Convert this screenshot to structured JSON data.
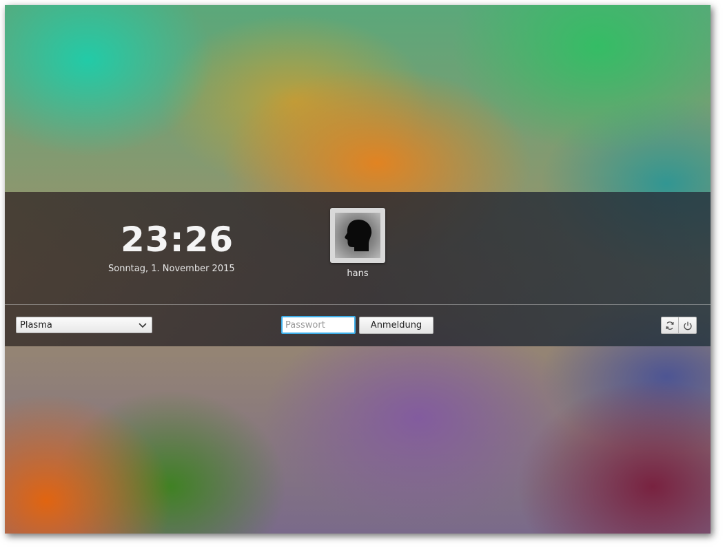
{
  "clock": {
    "time": "23:26",
    "date": "Sonntag, 1. November 2015"
  },
  "user": {
    "name": "hans",
    "avatar_icon": "user-head-icon"
  },
  "session": {
    "selected": "Plasma",
    "icon": "chevron-down-icon"
  },
  "login": {
    "password_placeholder": "Passwort",
    "login_label": "Anmeldung"
  },
  "power": {
    "restart_icon": "restart-icon",
    "shutdown_icon": "power-icon"
  },
  "colors": {
    "accent": "#3daee9",
    "panel": "#3f3a3c"
  }
}
